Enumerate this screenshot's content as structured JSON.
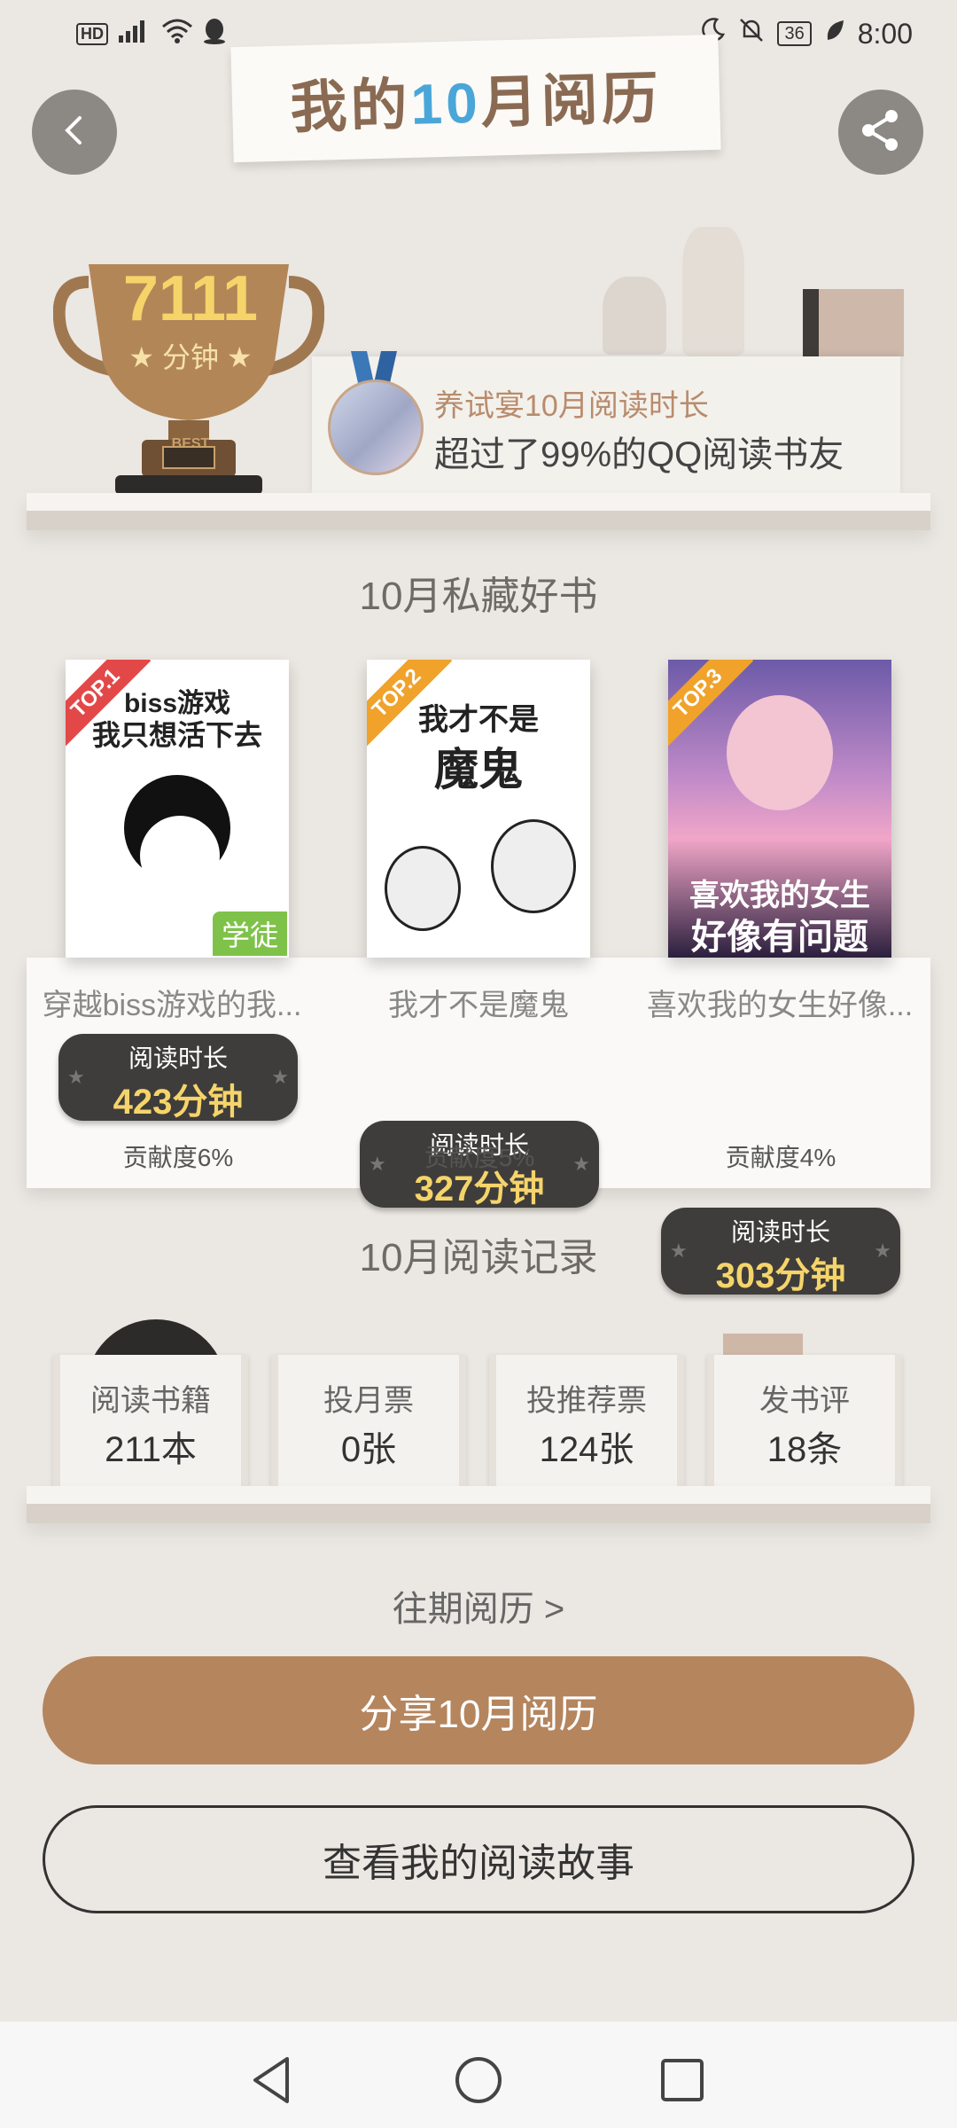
{
  "status_bar": {
    "left_text": "HD 4G",
    "time": "8:00",
    "battery": "36"
  },
  "header": {
    "title_prefix": "我的",
    "title_number": "10",
    "title_suffix": "月阅历"
  },
  "trophy": {
    "minutes": "7111",
    "unit": "分钟",
    "badge": "BEST"
  },
  "stats": {
    "line1": "养试宴10月阅读时长",
    "line2": "超过了99%的QQ阅读书友"
  },
  "books_section_title": "10月私藏好书",
  "books": [
    {
      "rank": "TOP.1",
      "cover_line1": "biss游戏",
      "cover_line2": "我只想活下去",
      "badge": "学徒",
      "title": "穿越biss游戏的我...",
      "read_label": "阅读时长",
      "read_value": "423分钟",
      "contribution": "贡献度6%"
    },
    {
      "rank": "TOP.2",
      "cover_line1": "我才不是",
      "cover_line2": "魔鬼",
      "title": "我才不是魔鬼",
      "read_label": "阅读时长",
      "read_value": "327分钟",
      "contribution": "贡献度5%"
    },
    {
      "rank": "TOP.3",
      "cover_line1": "喜欢我的女生",
      "cover_line2": "好像有问题",
      "title": "喜欢我的女生好像...",
      "read_label": "阅读时长",
      "read_value": "303分钟",
      "contribution": "贡献度4%"
    }
  ],
  "records_section_title": "10月阅读记录",
  "records": [
    {
      "label": "阅读书籍",
      "value": "211本"
    },
    {
      "label": "投月票",
      "value": "0张"
    },
    {
      "label": "投推荐票",
      "value": "124张"
    },
    {
      "label": "发书评",
      "value": "18条"
    }
  ],
  "past_link": "往期阅历 >",
  "share_button": "分享10月阅历",
  "story_button": "查看我的阅读故事",
  "icons": {
    "back": "chevron-left-icon",
    "share": "share-icon",
    "nav_back": "triangle-back-icon",
    "nav_home": "circle-home-icon",
    "nav_recent": "square-recent-icon"
  },
  "colors": {
    "accent": "#b5855e",
    "title_brown": "#8a6a52",
    "title_blue": "#4aa6d8",
    "gold": "#f5d46a"
  }
}
